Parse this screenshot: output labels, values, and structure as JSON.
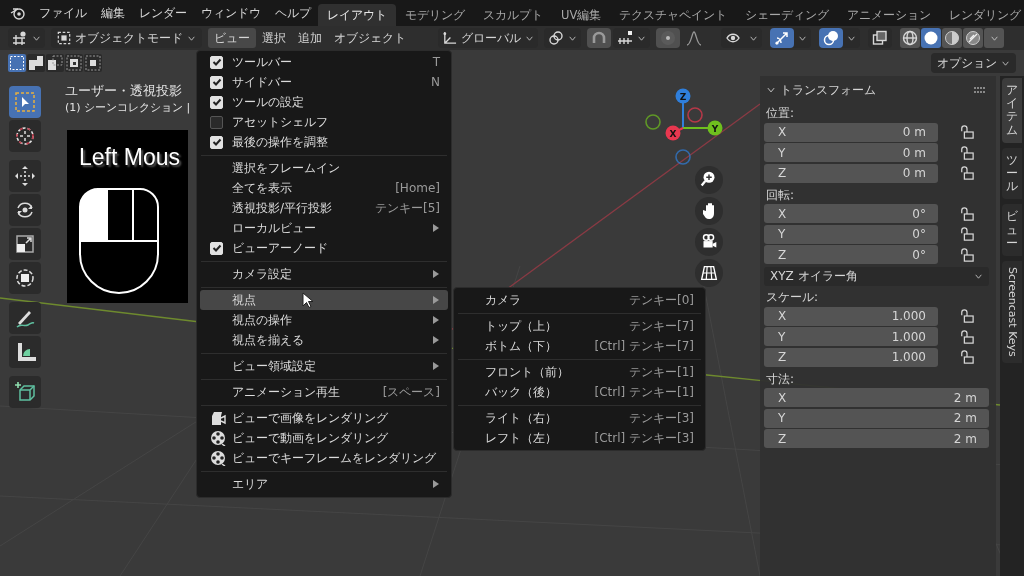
{
  "menubar": {
    "items": [
      "ファイル",
      "編集",
      "レンダー",
      "ウィンドウ",
      "ヘルプ"
    ]
  },
  "workspace_tabs": [
    {
      "label": "レイアウト",
      "selected": true
    },
    {
      "label": "モデリング",
      "selected": false
    },
    {
      "label": "スカルプト",
      "selected": false
    },
    {
      "label": "UV編集",
      "selected": false
    },
    {
      "label": "テクスチャペイント",
      "selected": false
    },
    {
      "label": "シェーディング",
      "selected": false
    },
    {
      "label": "アニメーション",
      "selected": false
    },
    {
      "label": "レンダリング",
      "selected": false
    }
  ],
  "header": {
    "mode": "オブジェクトモード",
    "menus": [
      {
        "label": "ビュー",
        "selected": true
      },
      {
        "label": "選択",
        "selected": false
      },
      {
        "label": "追加",
        "selected": false
      },
      {
        "label": "オブジェクト",
        "selected": false
      }
    ],
    "orientation": "グローバル",
    "toggles": [
      {
        "kind": "visibility",
        "on": false
      },
      {
        "kind": "gizmos",
        "on": true
      },
      {
        "kind": "overlays",
        "on": true
      },
      {
        "kind": "xray",
        "on": false
      }
    ],
    "shading_modes": [
      {
        "kind": "wireframe",
        "selected": false
      },
      {
        "kind": "solid",
        "selected": true
      },
      {
        "kind": "material",
        "selected": false
      },
      {
        "kind": "rendered",
        "selected": false
      }
    ]
  },
  "select_modes": [
    {
      "kind": "new",
      "selected": true
    },
    {
      "kind": "extend",
      "selected": false
    },
    {
      "kind": "subtract",
      "selected": false
    },
    {
      "kind": "invert",
      "selected": false
    },
    {
      "kind": "intersect",
      "selected": false
    }
  ],
  "options": "オプション",
  "tool_groups": [
    {
      "tools": [
        {
          "kind": "select",
          "selected": true
        },
        {
          "kind": "cursor",
          "selected": false
        }
      ]
    },
    {
      "tools": [
        {
          "kind": "move",
          "selected": false
        },
        {
          "kind": "rotate",
          "selected": false
        },
        {
          "kind": "scale",
          "selected": false
        },
        {
          "kind": "transform",
          "selected": false
        }
      ]
    },
    {
      "tools": [
        {
          "kind": "annotate",
          "selected": false
        },
        {
          "kind": "measure",
          "selected": false
        }
      ]
    },
    {
      "tools": [
        {
          "kind": "add_cube",
          "selected": false
        }
      ]
    }
  ],
  "viewport": {
    "view_name": "ユーザー・透視投影",
    "collection": "(1) シーンコレクション |",
    "screencast": {
      "text": "Left Mous",
      "mouse_buttons": [
        {
          "kind": "left",
          "pressed": true
        },
        {
          "kind": "middle",
          "pressed": false
        },
        {
          "kind": "right",
          "pressed": false
        }
      ]
    },
    "gizmo": {
      "axes": [
        {
          "label": "Z",
          "color": "#2f7fdc"
        },
        {
          "label": "Y",
          "color": "#6fbf1e"
        },
        {
          "label": "X",
          "color": "#e8374f"
        }
      ]
    }
  },
  "view_menu": {
    "sections": [
      {
        "items": [
          {
            "kind": "check",
            "label": "ツールバー",
            "shortcut": "T",
            "checked": true,
            "selected": false
          },
          {
            "kind": "check",
            "label": "サイドバー",
            "shortcut": "N",
            "checked": true,
            "selected": false
          },
          {
            "kind": "check",
            "label": "ツールの設定",
            "checked": true,
            "selected": false
          },
          {
            "kind": "check",
            "label": "アセットシェルフ",
            "checked": false,
            "selected": false
          },
          {
            "kind": "check",
            "label": "最後の操作を調整",
            "checked": true,
            "selected": false
          }
        ]
      },
      {
        "items": [
          {
            "kind": "action",
            "label": "選択をフレームイン",
            "selected": false
          },
          {
            "kind": "action",
            "label": "全てを表示",
            "shortcut": "[Home]",
            "selected": false
          },
          {
            "kind": "action",
            "label": "透視投影/平行投影",
            "shortcut": "テンキー[5]",
            "selected": false
          },
          {
            "kind": "submenu",
            "label": "ローカルビュー",
            "selected": false
          },
          {
            "kind": "check",
            "label": "ビューアーノード",
            "checked": true,
            "selected": false
          }
        ]
      },
      {
        "items": [
          {
            "kind": "submenu",
            "label": "カメラ設定",
            "selected": false
          }
        ]
      },
      {
        "items": [
          {
            "kind": "submenu",
            "label": "視点",
            "selected": true
          },
          {
            "kind": "submenu",
            "label": "視点の操作",
            "selected": false
          },
          {
            "kind": "submenu",
            "label": "視点を揃える",
            "selected": false
          }
        ]
      },
      {
        "items": [
          {
            "kind": "submenu",
            "label": "ビュー領域設定",
            "selected": false
          }
        ]
      },
      {
        "items": [
          {
            "kind": "action",
            "label": "アニメーション再生",
            "shortcut": "[スペース]",
            "selected": false
          }
        ]
      },
      {
        "items": [
          {
            "kind": "render_image",
            "label": "ビューで画像をレンダリング",
            "selected": false
          },
          {
            "kind": "render_animation",
            "label": "ビューで動画をレンダリング",
            "selected": false
          },
          {
            "kind": "render_animation",
            "label": "ビューでキーフレームをレンダリング",
            "selected": false
          }
        ]
      },
      {
        "items": [
          {
            "kind": "submenu",
            "label": "エリア",
            "selected": false
          }
        ]
      }
    ]
  },
  "viewpoint_menu": {
    "sections": [
      {
        "items": [
          {
            "label": "カメラ",
            "shortcut": "テンキー[0]"
          }
        ]
      },
      {
        "items": [
          {
            "label": "トップ（上）",
            "shortcut": "テンキー[7]"
          },
          {
            "label": "ボトム（下）",
            "shortcut": "[Ctrl] テンキー[7]"
          }
        ]
      },
      {
        "items": [
          {
            "label": "フロント（前）",
            "shortcut": "テンキー[1]"
          },
          {
            "label": "バック（後）",
            "shortcut": "[Ctrl] テンキー[1]"
          }
        ]
      },
      {
        "items": [
          {
            "label": "ライト（右）",
            "shortcut": "テンキー[3]"
          },
          {
            "label": "レフト（左）",
            "shortcut": "[Ctrl] テンキー[3]"
          }
        ]
      }
    ]
  },
  "sidebar": {
    "panel": {
      "title": "トランスフォーム",
      "expanded": true
    },
    "groups": [
      {
        "label": "位置:",
        "fields": [
          {
            "axis": "X",
            "value": "0 m",
            "locked": false
          },
          {
            "axis": "Y",
            "value": "0 m",
            "locked": false
          },
          {
            "axis": "Z",
            "value": "0 m",
            "locked": false
          }
        ]
      },
      {
        "label": "回転:",
        "fields": [
          {
            "axis": "X",
            "value": "0°",
            "locked": false
          },
          {
            "axis": "Y",
            "value": "0°",
            "locked": false
          },
          {
            "axis": "Z",
            "value": "0°",
            "locked": false
          }
        ],
        "dropdown": "XYZ オイラー角"
      },
      {
        "label": "スケール:",
        "fields": [
          {
            "axis": "X",
            "value": "1.000",
            "locked": false
          },
          {
            "axis": "Y",
            "value": "1.000",
            "locked": false
          },
          {
            "axis": "Z",
            "value": "1.000",
            "locked": false
          }
        ]
      },
      {
        "label": "寸法:",
        "fields": [
          {
            "axis": "X",
            "value": "2 m"
          },
          {
            "axis": "Y",
            "value": "2 m"
          },
          {
            "axis": "Z",
            "value": "2 m"
          }
        ]
      }
    ]
  },
  "sidebar_tabs": [
    {
      "kind": "vertical",
      "label": "アイテム",
      "selected": true
    },
    {
      "kind": "vertical",
      "label": "ツール",
      "selected": false
    },
    {
      "kind": "vertical",
      "label": "ビュー",
      "selected": false
    },
    {
      "kind": "rotated",
      "label": "Screencast Keys",
      "selected": false
    }
  ]
}
